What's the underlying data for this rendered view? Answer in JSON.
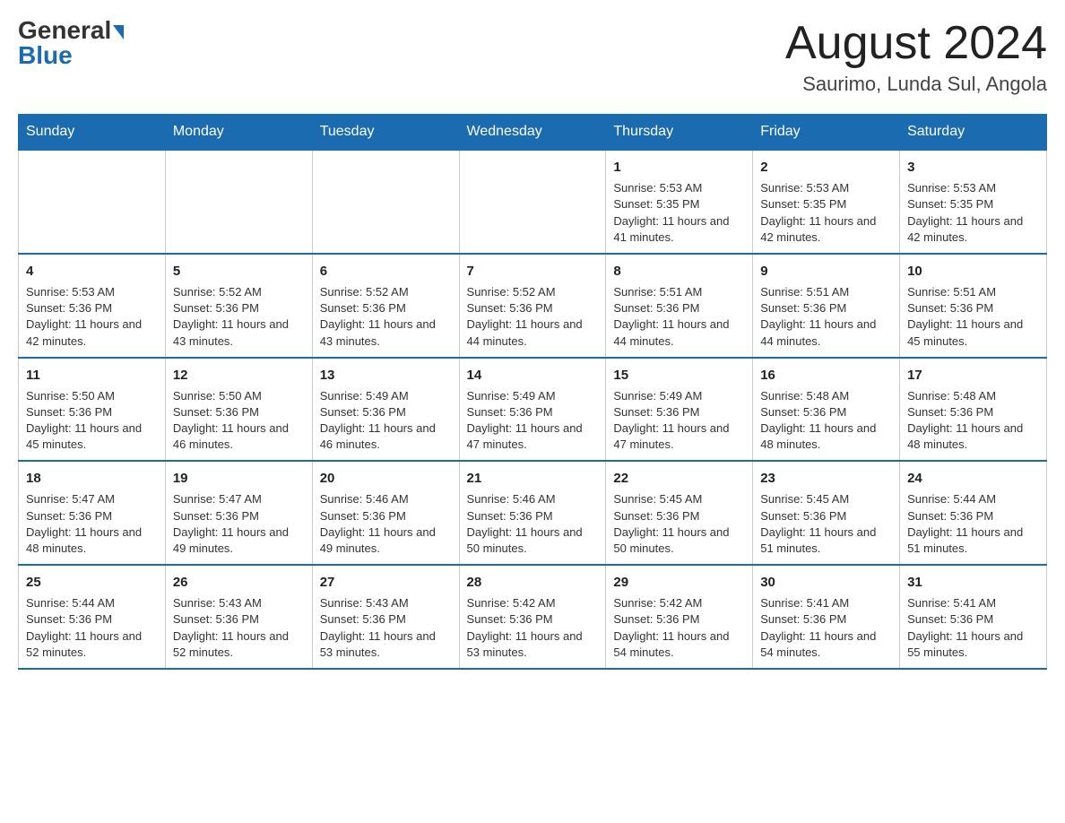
{
  "logo": {
    "general": "General",
    "blue": "Blue"
  },
  "title": "August 2024",
  "subtitle": "Saurimo, Lunda Sul, Angola",
  "headers": [
    "Sunday",
    "Monday",
    "Tuesday",
    "Wednesday",
    "Thursday",
    "Friday",
    "Saturday"
  ],
  "weeks": [
    [
      {
        "day": "",
        "info": ""
      },
      {
        "day": "",
        "info": ""
      },
      {
        "day": "",
        "info": ""
      },
      {
        "day": "",
        "info": ""
      },
      {
        "day": "1",
        "info": "Sunrise: 5:53 AM\nSunset: 5:35 PM\nDaylight: 11 hours and 41 minutes."
      },
      {
        "day": "2",
        "info": "Sunrise: 5:53 AM\nSunset: 5:35 PM\nDaylight: 11 hours and 42 minutes."
      },
      {
        "day": "3",
        "info": "Sunrise: 5:53 AM\nSunset: 5:35 PM\nDaylight: 11 hours and 42 minutes."
      }
    ],
    [
      {
        "day": "4",
        "info": "Sunrise: 5:53 AM\nSunset: 5:36 PM\nDaylight: 11 hours and 42 minutes."
      },
      {
        "day": "5",
        "info": "Sunrise: 5:52 AM\nSunset: 5:36 PM\nDaylight: 11 hours and 43 minutes."
      },
      {
        "day": "6",
        "info": "Sunrise: 5:52 AM\nSunset: 5:36 PM\nDaylight: 11 hours and 43 minutes."
      },
      {
        "day": "7",
        "info": "Sunrise: 5:52 AM\nSunset: 5:36 PM\nDaylight: 11 hours and 44 minutes."
      },
      {
        "day": "8",
        "info": "Sunrise: 5:51 AM\nSunset: 5:36 PM\nDaylight: 11 hours and 44 minutes."
      },
      {
        "day": "9",
        "info": "Sunrise: 5:51 AM\nSunset: 5:36 PM\nDaylight: 11 hours and 44 minutes."
      },
      {
        "day": "10",
        "info": "Sunrise: 5:51 AM\nSunset: 5:36 PM\nDaylight: 11 hours and 45 minutes."
      }
    ],
    [
      {
        "day": "11",
        "info": "Sunrise: 5:50 AM\nSunset: 5:36 PM\nDaylight: 11 hours and 45 minutes."
      },
      {
        "day": "12",
        "info": "Sunrise: 5:50 AM\nSunset: 5:36 PM\nDaylight: 11 hours and 46 minutes."
      },
      {
        "day": "13",
        "info": "Sunrise: 5:49 AM\nSunset: 5:36 PM\nDaylight: 11 hours and 46 minutes."
      },
      {
        "day": "14",
        "info": "Sunrise: 5:49 AM\nSunset: 5:36 PM\nDaylight: 11 hours and 47 minutes."
      },
      {
        "day": "15",
        "info": "Sunrise: 5:49 AM\nSunset: 5:36 PM\nDaylight: 11 hours and 47 minutes."
      },
      {
        "day": "16",
        "info": "Sunrise: 5:48 AM\nSunset: 5:36 PM\nDaylight: 11 hours and 48 minutes."
      },
      {
        "day": "17",
        "info": "Sunrise: 5:48 AM\nSunset: 5:36 PM\nDaylight: 11 hours and 48 minutes."
      }
    ],
    [
      {
        "day": "18",
        "info": "Sunrise: 5:47 AM\nSunset: 5:36 PM\nDaylight: 11 hours and 48 minutes."
      },
      {
        "day": "19",
        "info": "Sunrise: 5:47 AM\nSunset: 5:36 PM\nDaylight: 11 hours and 49 minutes."
      },
      {
        "day": "20",
        "info": "Sunrise: 5:46 AM\nSunset: 5:36 PM\nDaylight: 11 hours and 49 minutes."
      },
      {
        "day": "21",
        "info": "Sunrise: 5:46 AM\nSunset: 5:36 PM\nDaylight: 11 hours and 50 minutes."
      },
      {
        "day": "22",
        "info": "Sunrise: 5:45 AM\nSunset: 5:36 PM\nDaylight: 11 hours and 50 minutes."
      },
      {
        "day": "23",
        "info": "Sunrise: 5:45 AM\nSunset: 5:36 PM\nDaylight: 11 hours and 51 minutes."
      },
      {
        "day": "24",
        "info": "Sunrise: 5:44 AM\nSunset: 5:36 PM\nDaylight: 11 hours and 51 minutes."
      }
    ],
    [
      {
        "day": "25",
        "info": "Sunrise: 5:44 AM\nSunset: 5:36 PM\nDaylight: 11 hours and 52 minutes."
      },
      {
        "day": "26",
        "info": "Sunrise: 5:43 AM\nSunset: 5:36 PM\nDaylight: 11 hours and 52 minutes."
      },
      {
        "day": "27",
        "info": "Sunrise: 5:43 AM\nSunset: 5:36 PM\nDaylight: 11 hours and 53 minutes."
      },
      {
        "day": "28",
        "info": "Sunrise: 5:42 AM\nSunset: 5:36 PM\nDaylight: 11 hours and 53 minutes."
      },
      {
        "day": "29",
        "info": "Sunrise: 5:42 AM\nSunset: 5:36 PM\nDaylight: 11 hours and 54 minutes."
      },
      {
        "day": "30",
        "info": "Sunrise: 5:41 AM\nSunset: 5:36 PM\nDaylight: 11 hours and 54 minutes."
      },
      {
        "day": "31",
        "info": "Sunrise: 5:41 AM\nSunset: 5:36 PM\nDaylight: 11 hours and 55 minutes."
      }
    ]
  ]
}
